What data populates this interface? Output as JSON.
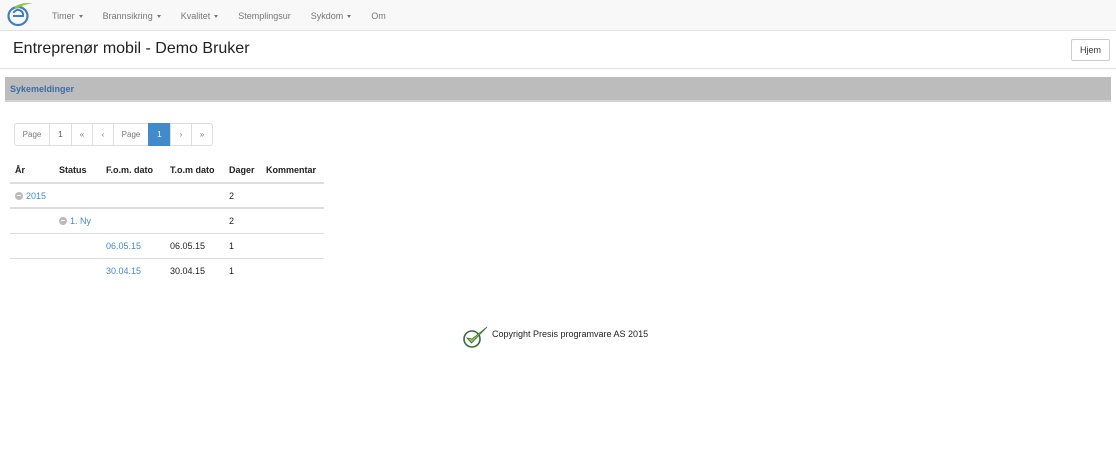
{
  "navbar": {
    "items": [
      {
        "label": "Timer",
        "dropdown": true
      },
      {
        "label": "Brannsikring",
        "dropdown": true
      },
      {
        "label": "Kvalitet",
        "dropdown": true
      },
      {
        "label": "Stemplingsur",
        "dropdown": false
      },
      {
        "label": "Sykdom",
        "dropdown": true
      },
      {
        "label": "Om",
        "dropdown": false
      }
    ]
  },
  "header": {
    "title": "Entreprenør mobil - Demo Bruker",
    "home_button": "Hjem"
  },
  "section": {
    "title": "Sykemeldinger"
  },
  "pager": {
    "page_label_1": "Page",
    "page_input_1": "1",
    "first": "«",
    "prev": "‹",
    "page_label_2": "Page",
    "current": "1",
    "next": "›",
    "last": "»"
  },
  "table": {
    "headers": [
      "År",
      "Status",
      "F.o.m. dato",
      "T.o.m dato",
      "Dager",
      "Kommentar"
    ],
    "year_row": {
      "year": "2015",
      "days": "2"
    },
    "status_row": {
      "status": "1. Ny",
      "days": "2"
    },
    "rows": [
      {
        "from": "06.05.15",
        "to": "06.05.15",
        "days": "1"
      },
      {
        "from": "30.04.15",
        "to": "30.04.15",
        "days": "1"
      }
    ]
  },
  "footer": {
    "copyright": "Copyright Presis programvare AS 2015"
  },
  "colors": {
    "accent": "#428bca",
    "section_title": "#3a6ea5",
    "section_bar": "#bcbcbc"
  }
}
